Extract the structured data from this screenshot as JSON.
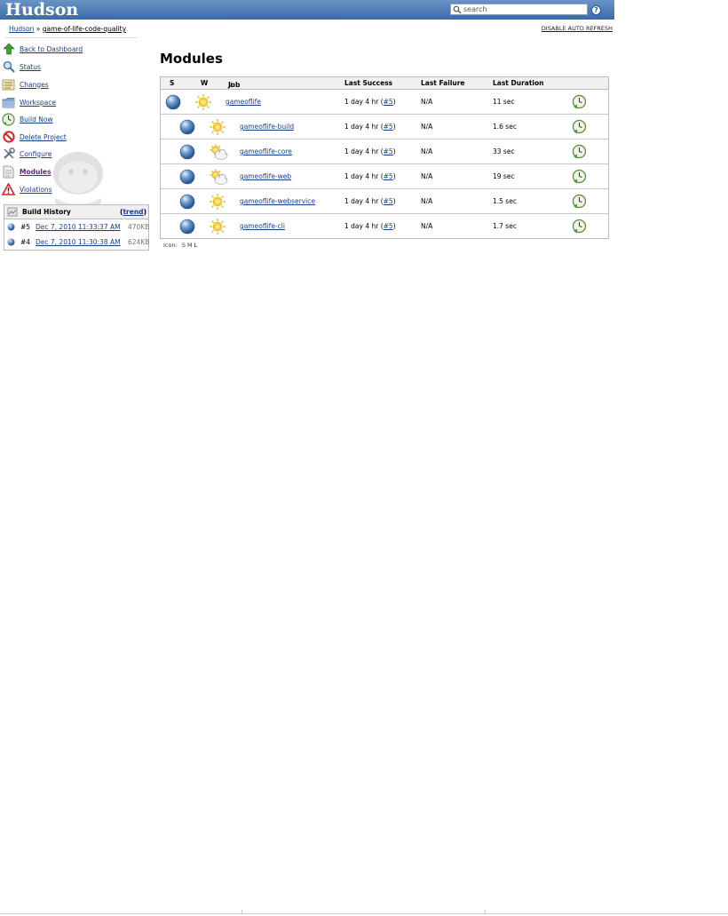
{
  "header": {
    "logo": "Hudson",
    "search_placeholder": "search",
    "help": "?"
  },
  "breadcrumb": {
    "root": "Hudson",
    "separator": "»",
    "project": "game-of-life-code-quality"
  },
  "auto_refresh": "DISABLE AUTO REFRESH",
  "sidebar": {
    "items": [
      {
        "label": "Back to Dashboard",
        "icon": "up-arrow-icon"
      },
      {
        "label": "Status",
        "icon": "magnifier-icon"
      },
      {
        "label": "Changes",
        "icon": "notepad-icon"
      },
      {
        "label": "Workspace",
        "icon": "folder-icon"
      },
      {
        "label": "Build Now",
        "icon": "clock-icon"
      },
      {
        "label": "Delete Project",
        "icon": "no-entry-icon"
      },
      {
        "label": "Configure",
        "icon": "wrench-icon"
      },
      {
        "label": "Modules",
        "icon": "document-icon"
      },
      {
        "label": "Violations",
        "icon": "warning-icon"
      }
    ]
  },
  "build_history": {
    "title": "Build History",
    "trend": "trend",
    "builds": [
      {
        "number": "#5",
        "date": "Dec 7, 2010 11:33:37 AM",
        "size": "470KB"
      },
      {
        "number": "#4",
        "date": "Dec 7, 2010 11:30:38 AM",
        "size": "624KB"
      }
    ]
  },
  "main": {
    "title": "Modules",
    "columns": [
      "S",
      "W",
      "Job",
      "↓",
      "Last Success",
      "Last Failure",
      "Last Duration"
    ],
    "rows": [
      {
        "job": "gameoflife",
        "success": "1 day 4 hr",
        "build": "#5",
        "failure": "N/A",
        "duration": "11 sec",
        "weather": "sunny"
      },
      {
        "job": "gameoflife-build",
        "success": "1 day 4 hr",
        "build": "#5",
        "failure": "N/A",
        "duration": "1.6 sec",
        "weather": "sunny"
      },
      {
        "job": "gameoflife-core",
        "success": "1 day 4 hr",
        "build": "#5",
        "failure": "N/A",
        "duration": "33 sec",
        "weather": "partly-cloudy"
      },
      {
        "job": "gameoflife-web",
        "success": "1 day 4 hr",
        "build": "#5",
        "failure": "N/A",
        "duration": "19 sec",
        "weather": "partly-cloudy"
      },
      {
        "job": "gameoflife-webservice",
        "success": "1 day 4 hr",
        "build": "#5",
        "failure": "N/A",
        "duration": "1.5 sec",
        "weather": "sunny"
      },
      {
        "job": "gameoflife-cli",
        "success": "1 day 4 hr",
        "build": "#5",
        "failure": "N/A",
        "duration": "1.7 sec",
        "weather": "sunny"
      }
    ],
    "icon_size": {
      "label": "Icon:",
      "sizes": [
        "S",
        "M",
        "L"
      ]
    }
  }
}
